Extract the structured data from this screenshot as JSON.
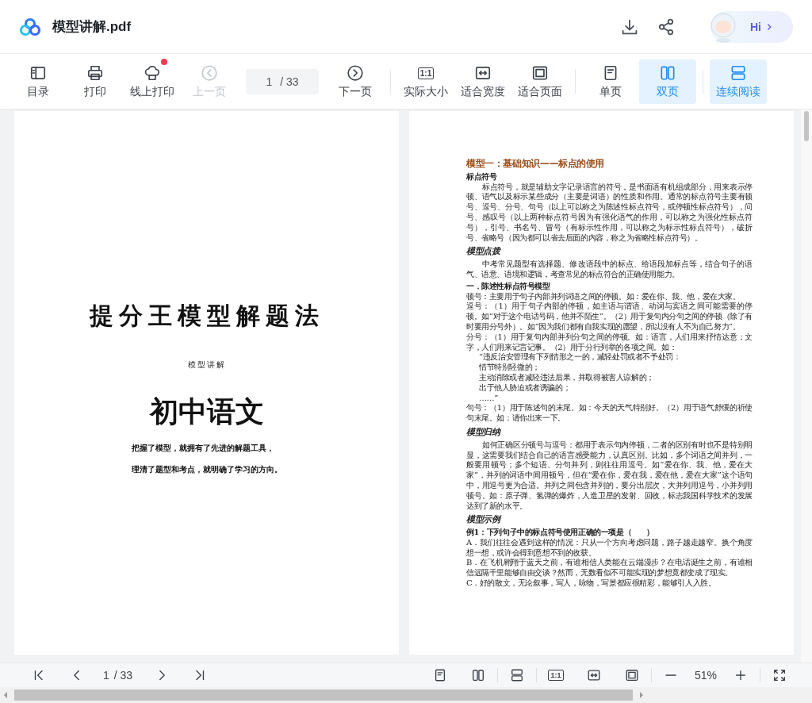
{
  "header": {
    "title": "模型讲解.pdf",
    "assistant": {
      "label": "Hi"
    }
  },
  "toolbar": {
    "groups": [
      {
        "items": [
          {
            "kind": "button",
            "label": "目录",
            "selected": false,
            "disabled": false,
            "badge": false
          },
          {
            "kind": "button",
            "label": "打印",
            "selected": false,
            "disabled": false,
            "badge": false
          },
          {
            "kind": "button",
            "label": "线上打印",
            "selected": false,
            "disabled": false,
            "badge": true
          },
          {
            "kind": "button",
            "label": "上一页",
            "selected": false,
            "disabled": true,
            "badge": false
          },
          {
            "kind": "page",
            "value": "1",
            "total": "/ 33"
          },
          {
            "kind": "button",
            "label": "下一页",
            "selected": false,
            "disabled": false,
            "badge": false
          }
        ]
      },
      {
        "items": [
          {
            "kind": "button",
            "label": "实际大小",
            "glyph": "1:1",
            "selected": false,
            "disabled": false,
            "badge": false
          },
          {
            "kind": "button",
            "label": "适合宽度",
            "selected": false,
            "disabled": false,
            "badge": false
          },
          {
            "kind": "button",
            "label": "适合页面",
            "selected": false,
            "disabled": false,
            "badge": false
          }
        ]
      },
      {
        "items": [
          {
            "kind": "button",
            "label": "单页",
            "selected": false,
            "disabled": false,
            "badge": false
          },
          {
            "kind": "button",
            "label": "双页",
            "selected": true,
            "disabled": false,
            "badge": false
          }
        ]
      },
      {
        "items": [
          {
            "kind": "button",
            "label": "连续阅读",
            "selected": true,
            "disabled": false,
            "badge": false
          }
        ]
      }
    ]
  },
  "pages": [
    {
      "kind": "cover",
      "title": "提分王模型解题法",
      "subtitle": "模型讲解",
      "heading": "初中语文",
      "lines": [
        "把握了模型，就拥有了先进的解题工具，",
        "理清了题型和考点，就明确了学习的方向。"
      ]
    },
    {
      "kind": "content",
      "blocks": [
        {
          "kind": "chapter",
          "text": "模型一：基础知识——标点的使用"
        },
        {
          "kind": "label",
          "text": "标点符号"
        },
        {
          "kind": "indent",
          "text": "标点符号，就是辅助文字记录语言的符号，是书面语有机组成部分，用来表示停顿、语气以及标示某些成分（主要是词语）的性质和作用。通常的标点符号主要有顿号、逗号、分号、句号（以上可以称之为陈述性标点符号，或停顿性标点符号），问号、感叹号（以上两种标点符号因为有强化语气的作用，可以称之为强化性标点符号），引号、书名号、冒号（有标示性作用，可以称之为标示性标点符号），破折号、省略号（因为都可以省去后面的内容，称之为省略性标点符号）。"
        },
        {
          "kind": "section",
          "text": "模型点拨"
        },
        {
          "kind": "indent",
          "text": "中考常见题型有选择题、修改语段中的标点、给语段加标点等，结合句子的语气、语意、语境和逻辑，考查常见的标点符合的正确使用能力。"
        },
        {
          "kind": "label",
          "text": "一．陈述性标点符号模型"
        },
        {
          "kind": "plain",
          "text": "顿号：主要用于句子内部并列词语之间的停顿。如：爱在你、我、他，爱在大家。"
        },
        {
          "kind": "plain",
          "text": "逗号：（1）用于句子内部的停顿，如主语与谓语、动词与宾语之间可能需要的停顿。如“对于这个电话号码，他并不陌生”。（2）用于复句内分句之间的停顿（除了有时要用分号外）。如“因为我们都有自我实现的愿望，所以没有人不为自己努力”。"
        },
        {
          "kind": "plain",
          "text": "分号：（1）用于复句内部并列分句之间的停顿。如：语言，人们用来抒情达意；文字，人们用来记言记事。（2）用于分行列举的各项之间。如："
        },
        {
          "kind": "quote",
          "text": "“违反治安管理有下列情形之一的，减轻处罚或者不予处罚："
        },
        {
          "kind": "quote",
          "text": "情节特别轻微的；"
        },
        {
          "kind": "quote",
          "text": "主动消除或者减轻违法后果，并取得被害人谅解的；"
        },
        {
          "kind": "quote",
          "text": "出于他人胁迫或者诱骗的；"
        },
        {
          "kind": "quote",
          "text": "……”"
        },
        {
          "kind": "plain",
          "text": "句号：（1）用于陈述句的末尾。如：今天的天气特别好。（2）用于语气舒缓的祈使句末尾。如：请你出来一下。"
        },
        {
          "kind": "section",
          "text": "模型归纳"
        },
        {
          "kind": "indent",
          "text": "如何正确区分顿号与逗号：都用于表示句内停顿，二者的区别有时也不是特别明显，这需要我们结合自己的语言感受能力，认真区别。比如，多个词语之间并列，一般要用顿号；多个短语、分句并列，则往往用逗号。如“爱在你、我、他，爱在大家”，并列的词语中间用顿号，但在“爱在你，爱在我，爱在他，爱在大家”这个语句中，用逗号更为合适。并列之间包含并列的，要分出层次，大并列用逗号，小并列用顿号。如：原子弹、氢弹的爆炸，人造卫星的发射、回收，标志我国科学技术的发展达到了新的水平。"
        },
        {
          "kind": "section",
          "text": "模型示例"
        },
        {
          "kind": "label",
          "text": "例1：下列句子中的标点符号使用正确的一项是（　　）"
        },
        {
          "kind": "plain",
          "text": "A．我们往往会遇到这样的情况：只从一个方向考虑问题，路子越走越窄。换个角度想一想，或许会得到意想不到的收获。"
        },
        {
          "kind": "plain",
          "text": "B．在飞机翱翔于蓝天之前，有谁相信人类能在云端漫步？在电话诞生之前，有谁相信远隔千里能够自由交谈？然而，无数看似不可能实现的梦想竟都变成了现实。"
        },
        {
          "kind": "plain",
          "text": "C．好的散文，无论叙事，写人，咏物，写景都应很精彩，能够引人入胜。"
        }
      ]
    }
  ],
  "bottom_bar": {
    "groups": [
      {
        "items": [
          {
            "kind": "button"
          },
          {
            "kind": "button"
          },
          {
            "kind": "page",
            "value": "1",
            "total": "/ 33"
          },
          {
            "kind": "button"
          },
          {
            "kind": "button"
          }
        ]
      },
      {
        "items": [
          {
            "kind": "button"
          },
          {
            "kind": "button"
          }
        ]
      },
      {
        "items": [
          {
            "kind": "button"
          }
        ]
      },
      {
        "items": [
          {
            "kind": "button",
            "glyph": "1:1"
          },
          {
            "kind": "button"
          },
          {
            "kind": "button"
          }
        ]
      },
      {
        "items": [
          {
            "kind": "button"
          },
          {
            "kind": "zoom",
            "value": "51%"
          },
          {
            "kind": "button"
          }
        ]
      },
      {
        "items": [
          {
            "kind": "button"
          }
        ]
      }
    ]
  }
}
